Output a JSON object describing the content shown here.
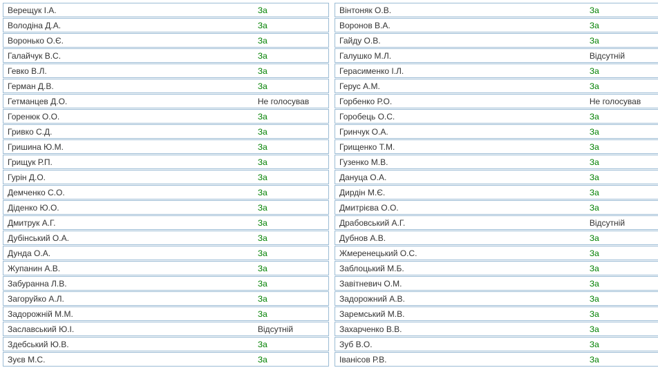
{
  "votes": {
    "za": "За",
    "absent": "Відсутній",
    "novote": "Не голосував"
  },
  "left": [
    {
      "name": "Верещук І.А.",
      "vote": "za"
    },
    {
      "name": "Володіна Д.А.",
      "vote": "za"
    },
    {
      "name": "Воронько О.Є.",
      "vote": "za"
    },
    {
      "name": "Галайчук В.С.",
      "vote": "za"
    },
    {
      "name": "Гевко В.Л.",
      "vote": "za"
    },
    {
      "name": "Герман Д.В.",
      "vote": "za"
    },
    {
      "name": "Гетманцев Д.О.",
      "vote": "novote"
    },
    {
      "name": "Горенюк О.О.",
      "vote": "za"
    },
    {
      "name": "Гривко С.Д.",
      "vote": "za"
    },
    {
      "name": "Гришина Ю.М.",
      "vote": "za"
    },
    {
      "name": "Грищук Р.П.",
      "vote": "za"
    },
    {
      "name": "Гурін Д.О.",
      "vote": "za"
    },
    {
      "name": "Демченко С.О.",
      "vote": "za"
    },
    {
      "name": "Діденко Ю.О.",
      "vote": "za"
    },
    {
      "name": "Дмитрук А.Г.",
      "vote": "za"
    },
    {
      "name": "Дубінський О.А.",
      "vote": "za"
    },
    {
      "name": "Дунда О.А.",
      "vote": "za"
    },
    {
      "name": "Жупанин А.В.",
      "vote": "za"
    },
    {
      "name": "Забуранна Л.В.",
      "vote": "za"
    },
    {
      "name": "Загоруйко А.Л.",
      "vote": "za"
    },
    {
      "name": "Задорожній М.М.",
      "vote": "za"
    },
    {
      "name": "Заславський Ю.І.",
      "vote": "absent"
    },
    {
      "name": "Здебський Ю.В.",
      "vote": "za"
    },
    {
      "name": "Зуєв М.С.",
      "vote": "za"
    }
  ],
  "right": [
    {
      "name": "Вінтоняк О.В.",
      "vote": "za"
    },
    {
      "name": "Воронов В.А.",
      "vote": "za"
    },
    {
      "name": "Гайду О.В.",
      "vote": "za"
    },
    {
      "name": "Галушко М.Л.",
      "vote": "absent"
    },
    {
      "name": "Герасименко І.Л.",
      "vote": "za"
    },
    {
      "name": "Герус А.М.",
      "vote": "za"
    },
    {
      "name": "Горбенко Р.О.",
      "vote": "novote"
    },
    {
      "name": "Горобець О.С.",
      "vote": "za"
    },
    {
      "name": "Гринчук О.А.",
      "vote": "za"
    },
    {
      "name": "Грищенко Т.М.",
      "vote": "za"
    },
    {
      "name": "Гузенко М.В.",
      "vote": "za"
    },
    {
      "name": "Дануца О.А.",
      "vote": "za"
    },
    {
      "name": "Дирдін М.Є.",
      "vote": "za"
    },
    {
      "name": "Дмитрієва О.О.",
      "vote": "za"
    },
    {
      "name": "Драбовський А.Г.",
      "vote": "absent"
    },
    {
      "name": "Дубнов А.В.",
      "vote": "za"
    },
    {
      "name": "Жмеренецький О.С.",
      "vote": "za"
    },
    {
      "name": "Заблоцький М.Б.",
      "vote": "za"
    },
    {
      "name": "Завітневич О.М.",
      "vote": "za"
    },
    {
      "name": "Задорожний А.В.",
      "vote": "za"
    },
    {
      "name": "Заремський М.В.",
      "vote": "za"
    },
    {
      "name": "Захарченко В.В.",
      "vote": "za"
    },
    {
      "name": "Зуб В.О.",
      "vote": "za"
    },
    {
      "name": "Іванісов Р.В.",
      "vote": "za"
    }
  ]
}
